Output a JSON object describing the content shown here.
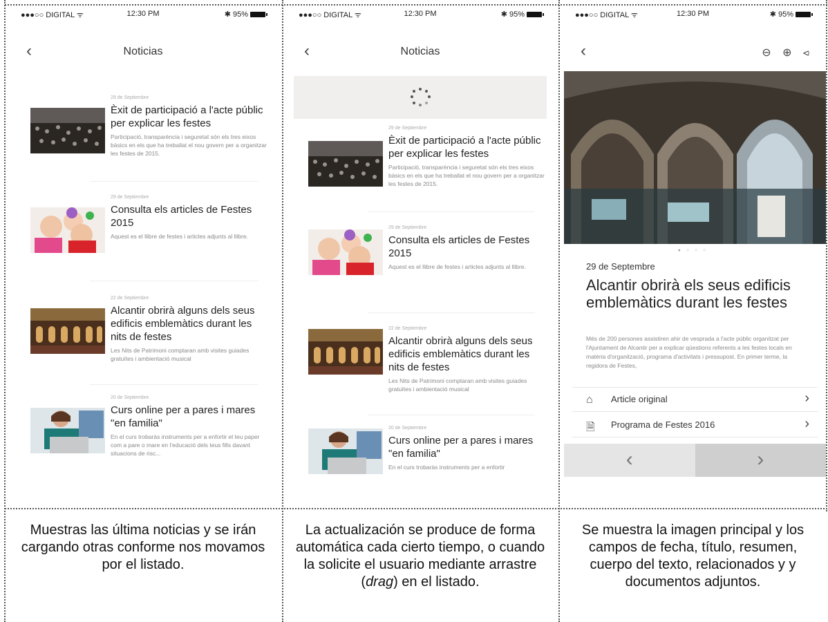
{
  "status_bar": {
    "carrier": "●●●○○ DIGITAL ᯤ",
    "time": "12:30 PM",
    "battery": "✱ 95%"
  },
  "list_screen": {
    "title": "Noticias",
    "back_icon": "chevron-left-icon",
    "items": [
      {
        "date": "29 de Septiembre",
        "title": "Èxit de participació a l'acte públic per explicar les festes",
        "summary": "Participació, transparència i seguretat són els tres eixos bàsics en els que ha treballat el nou govern per a organitzar les festes de 2015."
      },
      {
        "date": "29 de Septiembre",
        "title": "Consulta els articles de Festes 2015",
        "summary": "Aquest es el llibre de festes i articles adjunts al llibre."
      },
      {
        "date": "22 de Septiembre",
        "title": "Alcantir obrirà alguns dels seus edificis emblemàtics durant les nits de festes",
        "summary": "Les Nits de Patrimoni comptaran amb visites guiades gratuïtes i ambientació musical"
      },
      {
        "date": "20 de Septiembre",
        "title": "Curs online per a pares i mares \"en familia\"",
        "summary": "En el curs trobaràs instruments per a enfortir el teu paper com a pare o mare en l'educació dels teus fills davant situacions de risc..."
      }
    ]
  },
  "refresh_screen": {
    "title": "Noticias",
    "loader_icon": "loading-spinner-icon",
    "items": [
      {
        "date": "29 de Septiembre",
        "title": "Èxit de participació a l'acte públic per explicar les festes",
        "summary": "Participació, transparència i seguretat són els tres eixos bàsics en els que ha treballat el nou govern per a organitzar les festes de 2015."
      },
      {
        "date": "29 de Septiembre",
        "title": "Consulta els articles de Festes 2015",
        "summary": "Aquest es el llibre de festes i articles adjunts al llibre."
      },
      {
        "date": "22 de Septiembre",
        "title": "Alcantir obrirà alguns dels seus edificis emblemàtics durant les nits de festes",
        "summary": "Les Nits de Patrimoni comptaran amb visites guiades gratuïtes i ambientació musical"
      },
      {
        "date": "20 de Septiembre",
        "title": "Curs online per a pares i mares \"en familia\"",
        "summary": "En el curs trobaràs instruments per a enfortir"
      }
    ]
  },
  "detail_screen": {
    "actions": [
      "zoom-out-icon",
      "zoom-in-icon",
      "share-icon"
    ],
    "carousel_dots": "● ○ ○ ○",
    "date": "29 de Septembre",
    "title": "Alcantir obrirà els seus edificis emblemàtics durant les festes",
    "body": "Més de 200 persones assistiren ahir de vesprada a l'acte públic organitzat per l'Ajuntament de Alcantir per a explicar qüestions referents a les festes locals en matèria d'organització, programa d'activitats i pressupost. En primer terme, la regidora de Festes,",
    "links": [
      {
        "icon": "home-icon",
        "label": "Article original"
      },
      {
        "icon": "pdf-icon",
        "label": "Programa de Festes 2016"
      }
    ],
    "prev": "‹",
    "next": "›"
  },
  "captions": [
    "Muestras las  última noticias y se irán cargando otras conforme nos movamos por el listado.",
    "La actualización se produce de forma automática cada cierto tiempo, o cuando la solicite el usuario mediante arrastre (drag) en el listado.",
    "Se muestra la imagen principal y los campos de fecha, título, resumen, cuerpo del texto, relacionados y  y documentos adjuntos."
  ]
}
